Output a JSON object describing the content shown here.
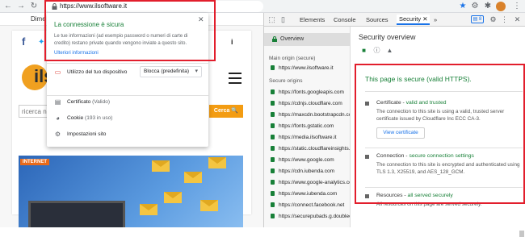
{
  "browser": {
    "url": "https://www.ilsoftware.it",
    "extension_badge": "1",
    "colors": {
      "accent": "#1a73e8",
      "secure": "#188038",
      "highlight": "#e21e2c"
    }
  },
  "page": {
    "tab_text": "Dime",
    "logo_text": "ils",
    "info_symbol": "i",
    "search_placeholder": "ricerca nel",
    "search_button": "Cerca",
    "hero_badge": "INTERNET"
  },
  "popup": {
    "title": "La connessione è sicura",
    "description": "Le tue informazioni (ad esempio password o numeri di carte di credito) restano private quando vengono inviate a questo sito.",
    "link": "Ulteriori informazioni",
    "device_usage": "Utilizzo del tuo dispositivo",
    "device_select": "Blocca (predefinita)",
    "certificate_label": "Certificato",
    "certificate_status": "(Valido)",
    "cookie_label": "Cookie",
    "cookie_status": "(193 in uso)",
    "settings_label": "Impostazioni sito"
  },
  "devtools": {
    "tabs": [
      "Elements",
      "Console",
      "Sources",
      "Security"
    ],
    "active_tab": "Security",
    "more_tabs": "»",
    "issue_count": "8",
    "sidebar": {
      "overview": "Overview",
      "main_origin_header": "Main origin (secure)",
      "main_origin": "https://www.ilsoftware.it",
      "secure_origins_header": "Secure origins",
      "secure_origins": [
        "https://fonts.googleapis.com",
        "https://cdnjs.cloudflare.com",
        "https://maxcdn.bootstrapcdn.com",
        "https://fonts.gstatic.com",
        "https://media.ilsoftware.it",
        "https://static.cloudflareinsights.com",
        "https://www.google.com",
        "https://cdn.iubenda.com",
        "https://www.google-analytics.com",
        "https://www.iubenda.com",
        "https://connect.facebook.net",
        "https://securepubads.g.doubleclick.net"
      ]
    },
    "main": {
      "title": "Security overview",
      "headline": "This page is secure (valid HTTPS).",
      "certificate": {
        "label": "Certificate",
        "status": "valid and trusted",
        "body": "The connection to this site is using a valid, trusted server certificate issued by Cloudflare Inc ECC CA-3.",
        "button": "View certificate"
      },
      "connection": {
        "label": "Connection",
        "status": "secure connection settings",
        "body": "The connection to this site is encrypted and authenticated using TLS 1.3, X25519, and AES_128_GCM."
      },
      "resources": {
        "label": "Resources",
        "status": "all served securely",
        "body": "All resources on this page are served securely."
      }
    }
  }
}
